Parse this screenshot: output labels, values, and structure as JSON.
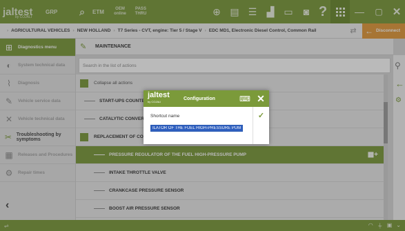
{
  "topbar": {
    "logo": "jaltest",
    "logo_sub": "by COJALI",
    "grp": "GRP",
    "etm": "ETM",
    "oem": "OEM",
    "oem_sub": "online",
    "pass": "PASS",
    "pass_sub": "THRU"
  },
  "breadcrumb": {
    "items": [
      "AGRICULTURAL VEHICLES",
      "NEW HOLLAND",
      "T7 Series - CVT, engine: Tier 5 / Stage V",
      "EDC MD1, Electronic Diesel Control, Common Rail"
    ],
    "disconnect_label": "Disconnect"
  },
  "sidebar": {
    "items": [
      {
        "label": "Diagnostics menu"
      },
      {
        "label": "System technical data"
      },
      {
        "label": "Diagnosis"
      },
      {
        "label": "Vehicle service data"
      },
      {
        "label": "Vehicle technical data"
      },
      {
        "label": "Troubleshooting by symptoms"
      },
      {
        "label": "Releases and Procedures"
      },
      {
        "label": "Repair times"
      }
    ]
  },
  "main": {
    "title": "MAINTENANCE",
    "search_placeholder": "Search in the list of actions",
    "rows": [
      {
        "label": "Collapse all actions"
      },
      {
        "label": "START-UPS COUNTER RESET"
      },
      {
        "label": "CATALYTIC CONVERTER"
      },
      {
        "label": "REPLACEMENT OF COMPONENTS"
      },
      {
        "label": "PRESSURE REGULATOR OF THE FUEL HIGH-PRESSURE PUMP"
      },
      {
        "label": "INTAKE THROTTLE VALVE"
      },
      {
        "label": "CRANKCASE PRESSURE SENSOR"
      },
      {
        "label": "BOOST AIR PRESSURE SENSOR"
      }
    ]
  },
  "dialog": {
    "logo": "jaltest",
    "logo_sub": "by COJALI",
    "title": "Configuration",
    "field_label": "Shortcut name",
    "field_value": "ILATOR OF THE FUEL HIGH-PRESSURE PUMP"
  },
  "colors": {
    "brand_green": "#7b9a3a",
    "disconnect_orange": "#e39a3a",
    "selection_blue": "#2f5fbf"
  }
}
